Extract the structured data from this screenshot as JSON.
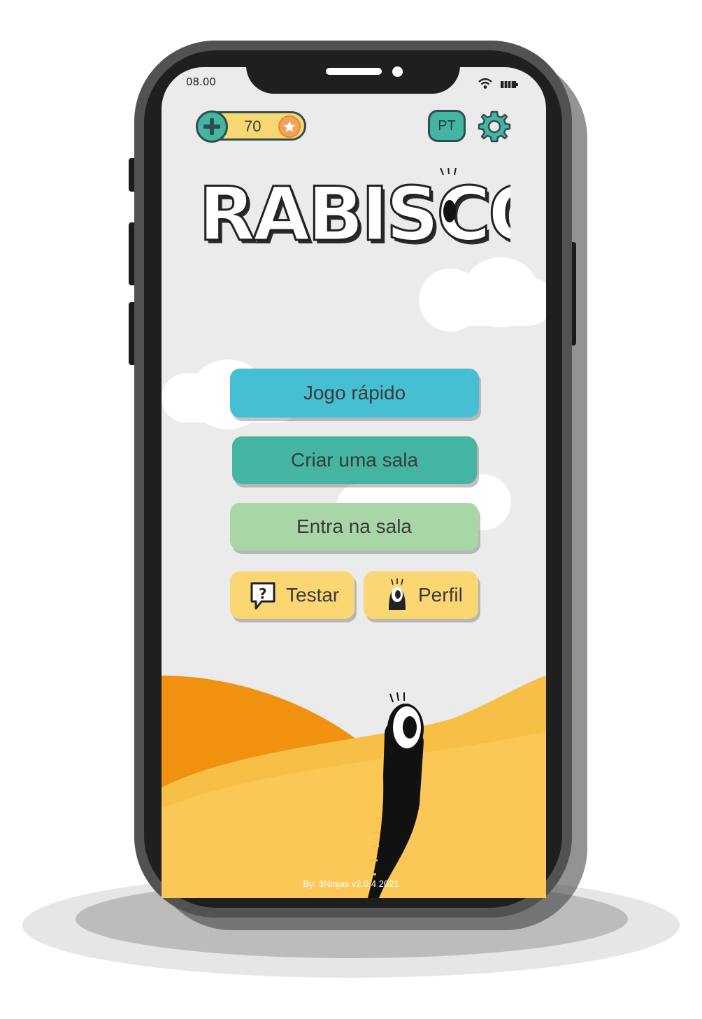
{
  "status_bar": {
    "time": "08.00"
  },
  "header": {
    "coins": "70",
    "language": "PT"
  },
  "logo": {
    "title": "RABISCOS"
  },
  "menu": {
    "quick_game": "Jogo rápido",
    "create_room": "Criar uma sala",
    "enter_room": "Entra na sala",
    "test": "Testar",
    "profile": "Perfil"
  },
  "footer": {
    "credit": "By: 3Ninjas v2.0.4 2021"
  },
  "colors": {
    "teal": "#45b5a3",
    "sky": "#47bfd3",
    "mint": "#a9d6a6",
    "yellow": "#fbd774",
    "orange": "#f0910f"
  },
  "icons": [
    "plus-icon",
    "star-coin-icon",
    "gear-icon",
    "help-bubble-icon",
    "eye-creature-icon",
    "wifi-icon",
    "battery-icon"
  ]
}
